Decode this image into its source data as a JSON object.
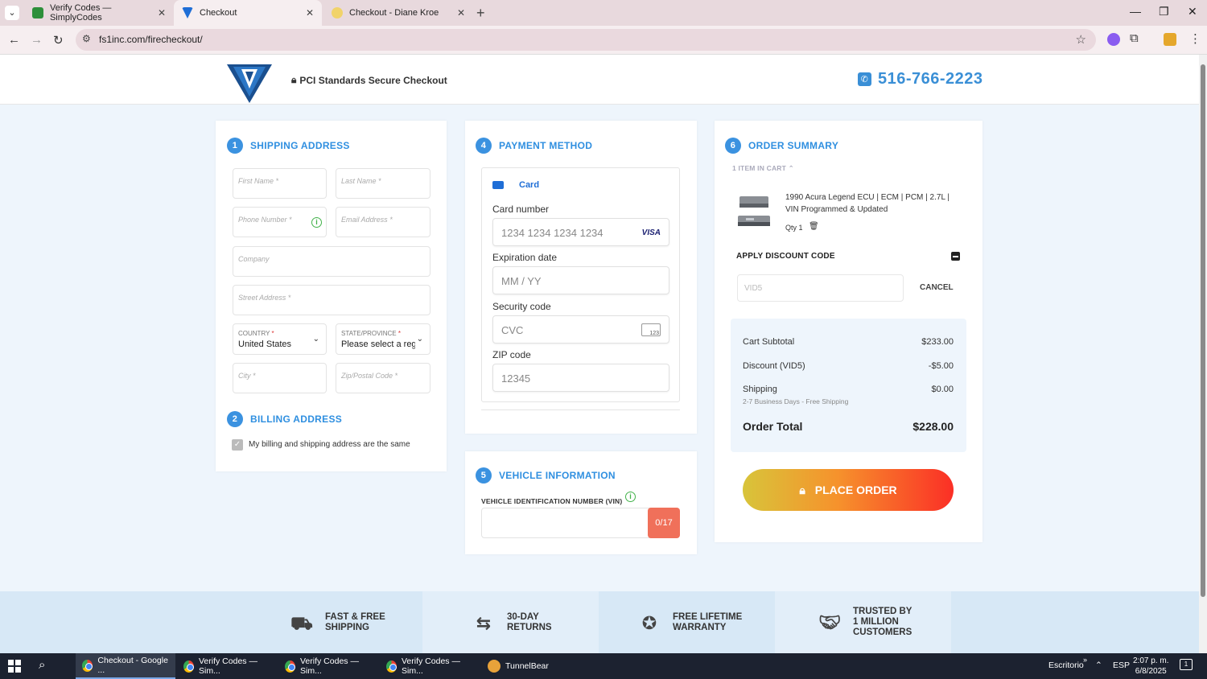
{
  "browser": {
    "tabs": [
      {
        "title": "Verify Codes — SimplyCodes"
      },
      {
        "title": "Checkout"
      },
      {
        "title": "Checkout - Diane Kroe"
      }
    ],
    "url": "fs1inc.com/firecheckout/"
  },
  "header": {
    "secure_text": "PCI Standards Secure Checkout",
    "phone": "516-766-2223"
  },
  "shipping": {
    "step": "1",
    "title": "SHIPPING ADDRESS",
    "first_name_ph": "First Name *",
    "last_name_ph": "Last Name *",
    "phone_ph": "Phone Number *",
    "email_ph": "Email Address *",
    "company_ph": "Company",
    "street_ph": "Street Address *",
    "country_label": "COUNTRY",
    "country_value": "United States",
    "state_label": "STATE/PROVINCE",
    "state_value": "Please select a regi",
    "required_mark": "*",
    "city_ph": "City *",
    "zip_ph": "Zip/Postal Code *"
  },
  "billing": {
    "step": "2",
    "title": "BILLING ADDRESS",
    "same_label": "My billing and shipping address are the same",
    "same_checked": true
  },
  "payment": {
    "step": "4",
    "title": "PAYMENT METHOD",
    "method_label": "Card",
    "card_number_label": "Card number",
    "card_number_ph": "1234 1234 1234 1234",
    "card_brand": "VISA",
    "expiry_label": "Expiration date",
    "expiry_ph": "MM / YY",
    "cvc_label": "Security code",
    "cvc_ph": "CVC",
    "cvc_icon_text": "123",
    "zip_label": "ZIP code",
    "zip_ph": "12345"
  },
  "vehicle": {
    "step": "5",
    "title": "VEHICLE INFORMATION",
    "vin_label": "VEHICLE IDENTIFICATION NUMBER (VIN)",
    "vin_count": "0/17"
  },
  "summary": {
    "step": "6",
    "title": "ORDER SUMMARY",
    "items_toggle": "1 ITEM IN CART",
    "product_title": "1990 Acura Legend ECU | ECM | PCM | 2.7L | VIN Programmed & Updated",
    "qty": "Qty 1",
    "discount_title": "APPLY DISCOUNT CODE",
    "discount_code": "VID5",
    "cancel": "CANCEL",
    "subtotal_label": "Cart Subtotal",
    "subtotal": "$233.00",
    "discount_label": "Discount (VID5)",
    "discount": "-$5.00",
    "shipping_label": "Shipping",
    "shipping_sub": "2-7 Business Days - Free Shipping",
    "shipping": "$0.00",
    "total_label": "Order Total",
    "total": "$228.00",
    "place_order": "PLACE ORDER"
  },
  "features": [
    {
      "line1": "FAST & FREE",
      "line2": "SHIPPING",
      "line3": "",
      "icon": "truck-icon"
    },
    {
      "line1": "30-DAY",
      "line2": "RETURNS",
      "line3": "",
      "icon": "returns-icon"
    },
    {
      "line1": "FREE LIFETIME",
      "line2": "WARRANTY",
      "line3": "",
      "icon": "award-icon"
    },
    {
      "line1": "TRUSTED BY",
      "line2": "1 MILLION",
      "line3": "CUSTOMERS",
      "icon": "handshake-icon"
    }
  ],
  "taskbar": {
    "items": [
      {
        "label": "Checkout - Google ..."
      },
      {
        "label": "Verify Codes — Sim..."
      },
      {
        "label": "Verify Codes — Sim..."
      },
      {
        "label": "Verify Codes — Sim..."
      },
      {
        "label": "TunnelBear"
      }
    ],
    "desktop": "Escritorio",
    "lang": "ESP",
    "time": "2:07 p. m.",
    "date": "6/8/2025",
    "notif_count": "1"
  },
  "colors": {
    "accent": "#2f8fe0",
    "vin_counter": "#f0705a",
    "place_order_gradient": [
      "#d8c43a",
      "#f6922c",
      "#fb2f26"
    ]
  }
}
